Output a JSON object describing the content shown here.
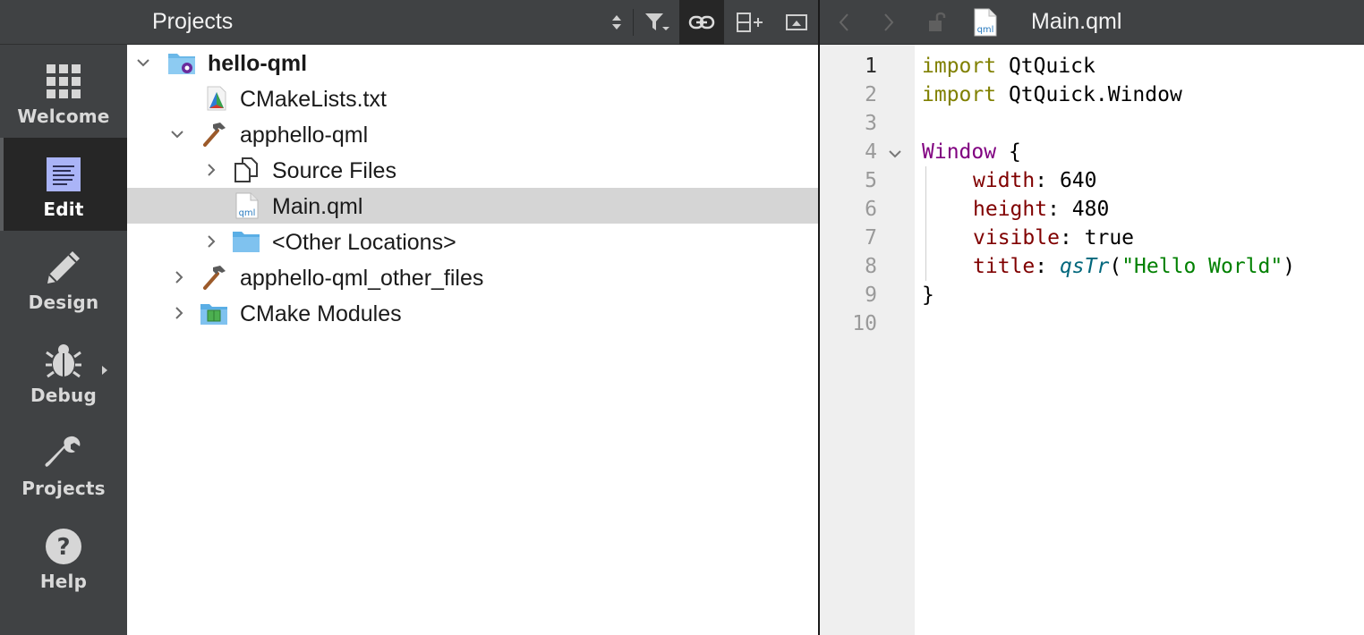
{
  "modes": [
    {
      "label": "Welcome",
      "icon": "grid-icon",
      "active": false
    },
    {
      "label": "Edit",
      "icon": "document-edit-icon",
      "active": true
    },
    {
      "label": "Design",
      "icon": "pencil-icon",
      "active": false
    },
    {
      "label": "Debug",
      "icon": "bug-icon",
      "active": false
    },
    {
      "label": "Projects",
      "icon": "wrench-icon",
      "active": false
    },
    {
      "label": "Help",
      "icon": "question-icon",
      "active": false
    }
  ],
  "project_pane": {
    "title": "Projects",
    "toolbar_icons": [
      "sort-updown-icon",
      "filter-icon",
      "link-icon",
      "split-add-icon",
      "close-pane-icon"
    ],
    "tree": [
      {
        "label": "hello-qml",
        "icon": "project-folder-icon",
        "expanded": true,
        "bold": true
      },
      {
        "label": "CMakeLists.txt",
        "icon": "cmake-icon"
      },
      {
        "label": "apphello-qml",
        "icon": "hammer-icon",
        "expanded": true
      },
      {
        "label": "Source Files",
        "icon": "source-files-icon",
        "expanded": false
      },
      {
        "label": "Main.qml",
        "icon": "qml-file-icon",
        "selected": true
      },
      {
        "label": "<Other Locations>",
        "icon": "folder-icon",
        "expanded": false
      },
      {
        "label": "apphello-qml_other_files",
        "icon": "hammer-icon",
        "expanded": false
      },
      {
        "label": "CMake Modules",
        "icon": "cmake-modules-icon",
        "expanded": false
      }
    ]
  },
  "editor": {
    "file_name": "Main.qml",
    "file_icon_text": "qml",
    "line_numbers": [
      "1",
      "2",
      "3",
      "4",
      "5",
      "6",
      "7",
      "8",
      "9",
      "10"
    ],
    "tokens": {
      "l1_kw": "import",
      "l1_rest": " QtQuick",
      "l2_kw": "import",
      "l2_rest": " QtQuick.Window",
      "l4_type": "Window",
      "l4_rest": " {",
      "l5_prop": "width",
      "l5_rest": ": 640",
      "l6_prop": "height",
      "l6_rest": ": 480",
      "l7_prop": "visible",
      "l7_rest": ": true",
      "l8_prop": "title",
      "l8_colon": ": ",
      "l8_fn": "qsTr",
      "l8_open": "(",
      "l8_str": "\"Hello World\"",
      "l8_close": ")",
      "l9": "}"
    }
  }
}
